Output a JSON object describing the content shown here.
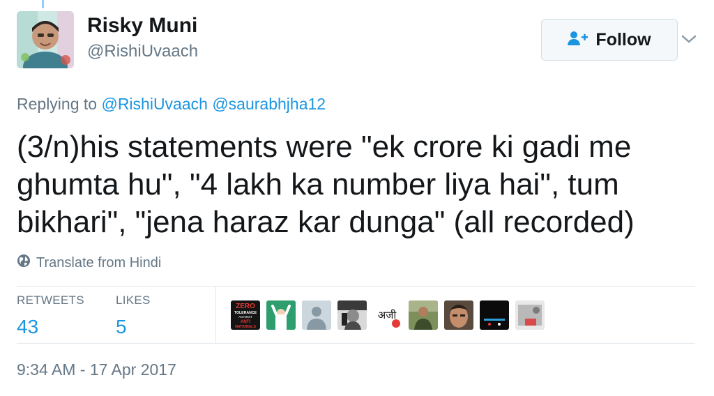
{
  "tweet": {
    "author": {
      "name": "Risky Muni",
      "handle": "@RishiUvaach"
    },
    "follow_label": "Follow",
    "replying": {
      "prefix": "Replying to",
      "mentions": [
        "@RishiUvaach",
        "@saurabhjha12"
      ]
    },
    "text": "(3/n)his statements were \"ek crore ki gadi me ghumta hu\", \"4 lakh ka number liya hai\", tum bikhari\", \"jena haraz kar dunga\" (all recorded)",
    "translate_label": "Translate from Hindi",
    "stats": {
      "retweets": {
        "label": "RETWEETS",
        "value": "43"
      },
      "likes": {
        "label": "LIKES",
        "value": "5"
      }
    },
    "likers": [
      {
        "icon": "zero-tolerance-logo",
        "text": [
          "ZERO",
          "TOLERANCE",
          "AGAINST",
          "ANTI",
          "NATIONALS"
        ]
      },
      {
        "icon": "person-arms-raised"
      },
      {
        "icon": "default-avatar"
      },
      {
        "icon": "bw-portrait"
      },
      {
        "icon": "devanagari-logo",
        "text": "अजी"
      },
      {
        "icon": "man-outdoors-photo"
      },
      {
        "icon": "face-closeup-photo"
      },
      {
        "icon": "dark-scene-photo"
      },
      {
        "icon": "poster-photo"
      }
    ],
    "timestamp": "9:34 AM - 17 Apr 2017"
  },
  "colors": {
    "link": "#1b95e0",
    "muted": "#657786",
    "text": "#14171a",
    "divider": "#e1e8ed"
  }
}
